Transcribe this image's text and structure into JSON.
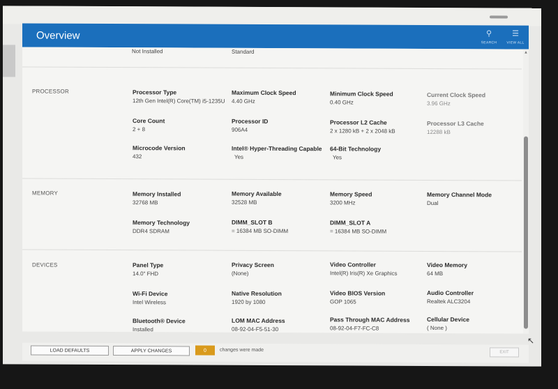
{
  "header": {
    "title": "Overview",
    "search_label": "SEARCH",
    "viewall_label": "VIEW ALL"
  },
  "top_partial": {
    "col1_value": "Not Installed",
    "col2_value": "Standard"
  },
  "processor": {
    "section_label": "PROCESSOR",
    "fields": [
      {
        "label": "Processor Type",
        "value": "12th Gen Intel(R) Core(TM) i5-1235U"
      },
      {
        "label": "Maximum Clock Speed",
        "value": "4.40 GHz"
      },
      {
        "label": "Minimum Clock Speed",
        "value": "0.40 GHz"
      },
      {
        "label": "Current Clock Speed",
        "value": "3.96 GHz"
      },
      {
        "label": "Core Count",
        "value": "2 + 8"
      },
      {
        "label": "Processor ID",
        "value": "906A4"
      },
      {
        "label": "Processor L2 Cache",
        "value": "2 x 1280  kB + 2 x 2048  kB"
      },
      {
        "label": "Processor L3 Cache",
        "value": "12288 kB"
      },
      {
        "label": "Microcode Version",
        "value": "432"
      },
      {
        "label": "Intel® Hyper-Threading Capable",
        "value": "Yes"
      },
      {
        "label": "64-Bit Technology",
        "value": "Yes"
      }
    ]
  },
  "memory": {
    "section_label": "MEMORY",
    "fields": [
      {
        "label": "Memory Installed",
        "value": "32768 MB"
      },
      {
        "label": "Memory Available",
        "value": "32528 MB"
      },
      {
        "label": "Memory Speed",
        "value": "3200 MHz"
      },
      {
        "label": "Memory Channel Mode",
        "value": "Dual"
      },
      {
        "label": "Memory Technology",
        "value": "DDR4 SDRAM"
      },
      {
        "label": "DIMM_SLOT B",
        "value": "= 16384 MB SO-DIMM"
      },
      {
        "label": "DIMM_SLOT A",
        "value": "= 16384 MB SO-DIMM"
      }
    ]
  },
  "devices": {
    "section_label": "DEVICES",
    "fields": [
      {
        "label": "Panel Type",
        "value": "14.0\" FHD"
      },
      {
        "label": "Privacy Screen",
        "value": "(None)"
      },
      {
        "label": "Video Controller",
        "value": "Intel(R) Iris(R) Xe Graphics"
      },
      {
        "label": "Video Memory",
        "value": "64 MB"
      },
      {
        "label": "Wi-Fi Device",
        "value": "Intel Wireless"
      },
      {
        "label": "Native Resolution",
        "value": "1920 by 1080"
      },
      {
        "label": "Video BIOS Version",
        "value": "GOP 1065"
      },
      {
        "label": "Audio Controller",
        "value": "Realtek ALC3204"
      },
      {
        "label": "Bluetooth® Device",
        "value": "Installed"
      },
      {
        "label": "LOM MAC Address",
        "value": "08-92-04-F5-51-30"
      },
      {
        "label": "Pass Through MAC Address",
        "value": "08-92-04-F7-FC-C8"
      },
      {
        "label": "Cellular Device",
        "value": "( None )"
      }
    ]
  },
  "footer": {
    "load_defaults": "LOAD DEFAULTS",
    "apply_changes": "APPLY CHANGES",
    "change_count": "0",
    "changes_text": "changes were made",
    "exit": "EXIT"
  },
  "colors": {
    "header_blue": "#1b6fbc",
    "count_badge": "#d99a1c"
  }
}
